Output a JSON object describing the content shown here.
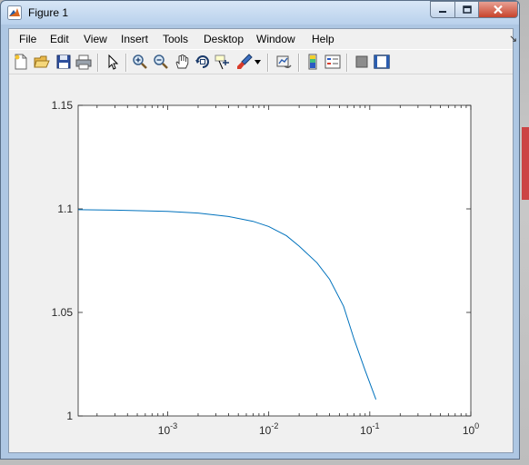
{
  "window": {
    "title": "Figure 1"
  },
  "menu": {
    "items": [
      "File",
      "Edit",
      "View",
      "Insert",
      "Tools",
      "Desktop",
      "Window",
      "Help"
    ],
    "overflow_icon": "dock-arrow-icon"
  },
  "toolbar": {
    "buttons": [
      "new-figure-icon",
      "open-file-icon",
      "save-icon",
      "print-icon",
      "edit-plot-arrow-icon",
      "zoom-in-icon",
      "zoom-out-icon",
      "pan-hand-icon",
      "rotate-3d-icon",
      "data-cursor-icon",
      "brush-icon",
      "link-plot-icon",
      "insert-colorbar-icon",
      "insert-legend-icon",
      "hide-plot-tools-icon",
      "show-plot-tools-icon"
    ]
  },
  "chart_data": {
    "type": "line",
    "title": "",
    "xlabel": "",
    "ylabel": "",
    "xscale": "log",
    "xlim": [
      0.00013,
      1
    ],
    "ylim": [
      1,
      1.15
    ],
    "xticks": [
      "10-3",
      "10-2",
      "10-1",
      "100"
    ],
    "yticks": [
      "1",
      "1.05",
      "1.1",
      "1.15"
    ],
    "grid": false,
    "series": [
      {
        "color": "#0072bd",
        "x": [
          0.00013,
          0.0003,
          0.001,
          0.002,
          0.004,
          0.007,
          0.01,
          0.015,
          0.02,
          0.03,
          0.04,
          0.055,
          0.07,
          0.09,
          0.115
        ],
        "y": [
          1.0996,
          1.0994,
          1.0988,
          1.098,
          1.0963,
          1.094,
          1.0915,
          1.087,
          1.082,
          1.074,
          1.066,
          1.053,
          1.037,
          1.022,
          1.008
        ]
      }
    ]
  }
}
